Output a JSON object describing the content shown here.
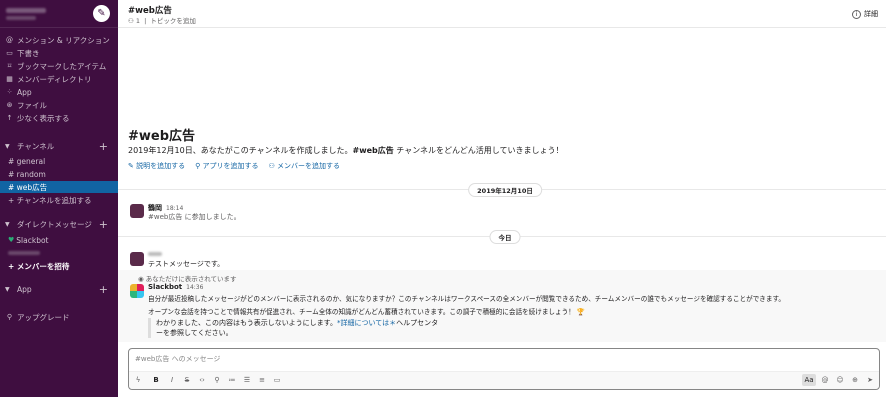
{
  "sidebar": {
    "nav": [
      {
        "icon": "@",
        "label": "メンション & リアクション"
      },
      {
        "icon": "▭",
        "label": "下書き"
      },
      {
        "icon": "⌑",
        "label": "ブックマークしたアイテム"
      },
      {
        "icon": "▦",
        "label": "メンバーディレクトリ"
      },
      {
        "icon": "⁘",
        "label": "App"
      },
      {
        "icon": "⊛",
        "label": "ファイル"
      },
      {
        "icon": "↑",
        "label": "少なく表示する"
      }
    ],
    "channels_title": "チャンネル",
    "channels": [
      {
        "label": "# general"
      },
      {
        "label": "# random"
      },
      {
        "label": "# web広告"
      },
      {
        "label": "+ チャンネルを追加する"
      }
    ],
    "dm_title": "ダイレクトメッセージ",
    "dms": [
      {
        "label": "Slackbot"
      },
      {
        "label": "+ メンバーを招待"
      }
    ],
    "app_title": "App",
    "upgrade": "アップグレード"
  },
  "header": {
    "title": "#web広告",
    "members": "1",
    "topic": "トピックを追加",
    "details": "詳細"
  },
  "intro": {
    "title": "#web広告",
    "text_before": "2019年12月10日、あなたがこのチャンネルを作成しました。",
    "text_channel": "#web広告",
    "text_after": " チャンネルをどんどん活用していきましょう！",
    "links": [
      "説明を追加する",
      "アプリを追加する",
      "メンバーを追加する"
    ]
  },
  "dividers": {
    "date1": "2019年12月10日",
    "date2": "今日"
  },
  "messages": {
    "m1": {
      "name": "鶴岡",
      "time": "18:14",
      "text": "#web広告 に参加しました。"
    },
    "m2": {
      "text": "テストメッセージです。"
    },
    "ephemeral_note": "あなただけに表示されています",
    "bot": {
      "name": "Slackbot",
      "time": "14:36",
      "line1": "自分が最近投稿したメッセージがどのメンバーに表示されるのか、気になりますか？このチャンネルはワークスペースの全メンバーが閲覧できるため、チームメンバーの誰でもメッセージを確認することができます。",
      "line2": "オープンな会話を持つことで情報共有が促進され、チーム全体の知識がどんどん蓄積されていきます。この調子で積極的に会話を続けましょう！",
      "quote1_before": "わかりました、この内容はもう表示しないようにします。",
      "quote1_link": "*詳細については＊",
      "quote1_after": "ヘルプセンタ",
      "quote2": "ーを参照してください。"
    }
  },
  "composer": {
    "placeholder": "#web広告 へのメッセージ"
  },
  "colors": {
    "sidebar": "#3f0e40",
    "active": "#1164a3",
    "link": "#1264a3",
    "online": "#2bac76"
  }
}
